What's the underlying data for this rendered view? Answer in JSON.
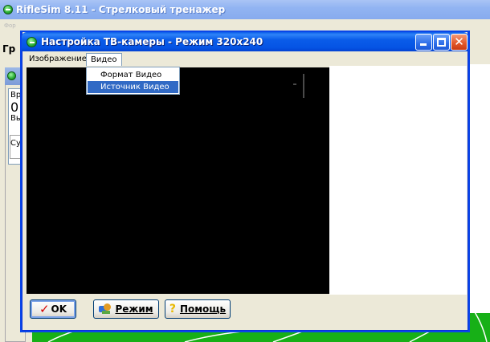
{
  "app": {
    "title": "RifleSim 8.11 - Стрелковый тренажер",
    "menu_ghost": "Фор",
    "toolbar_label": "Гр",
    "left_panel": {
      "line1": "Вр",
      "line2": "0",
      "line3": "Вь",
      "line4": "Су"
    }
  },
  "dialog": {
    "title": "Настройка ТВ-камеры - Режим 320x240",
    "menu": [
      {
        "label": "Изображение"
      },
      {
        "label": "Видео"
      }
    ],
    "dropdown": [
      {
        "label": "Формат Видео"
      },
      {
        "label": "Источник Видео"
      }
    ],
    "buttons": {
      "ok": "OK",
      "mode": "Режим",
      "help": "Помощь"
    }
  },
  "colors": {
    "titlebar_active": "#0a5ce9",
    "menu_highlight": "#316ac5",
    "target_green": "#17b017",
    "video_bg": "#000000"
  },
  "icons": {
    "app": "riflesim-logo-icon",
    "ok": "check-icon",
    "mode": "mode-icon",
    "help": "question-icon"
  }
}
